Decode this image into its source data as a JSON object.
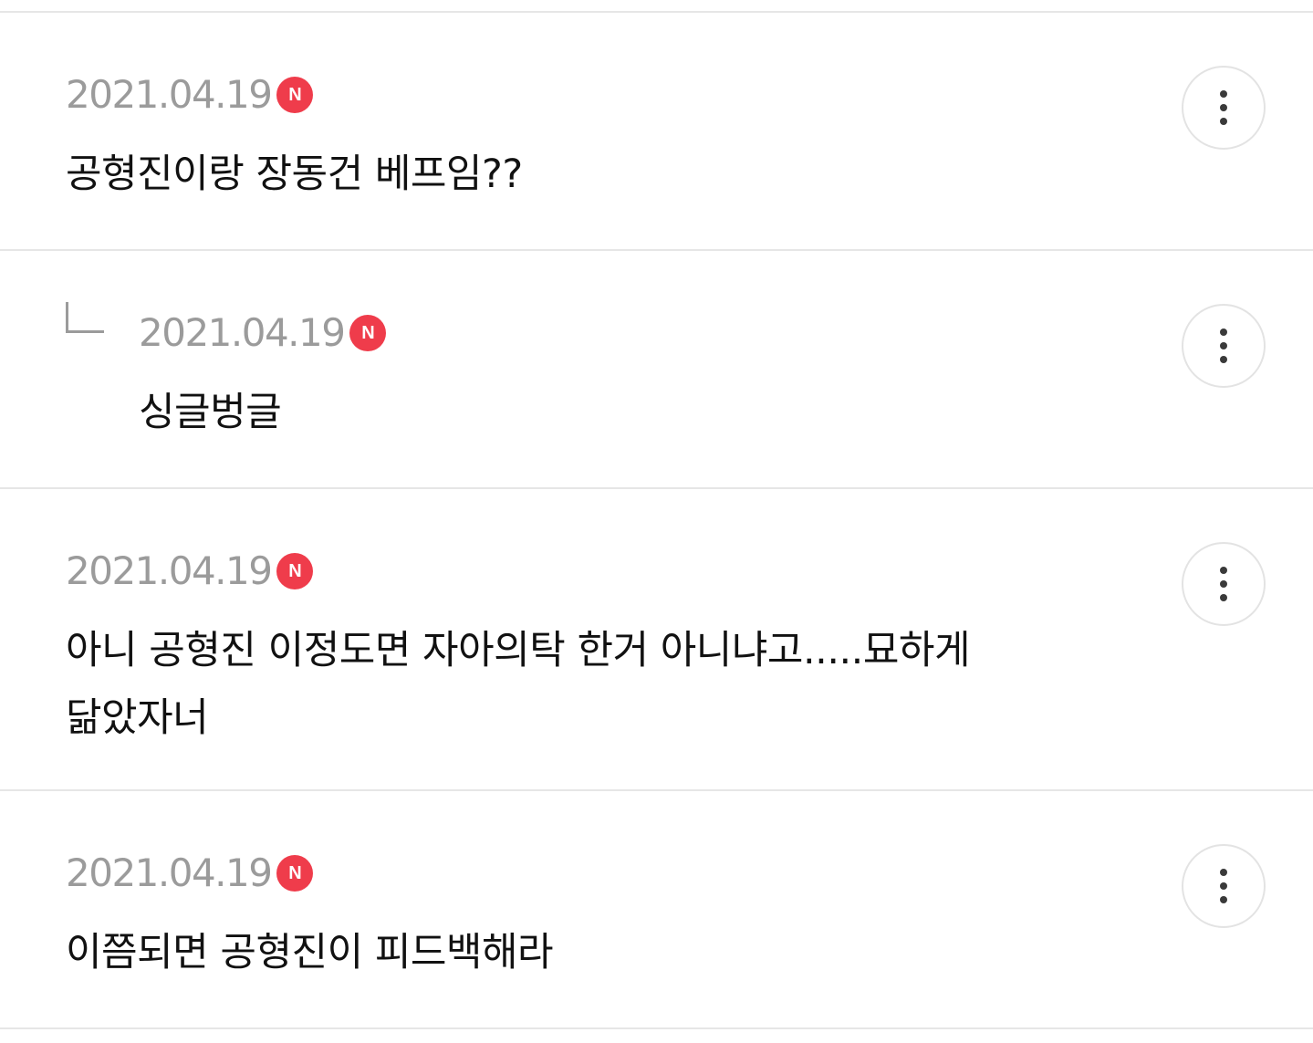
{
  "comments": [
    {
      "date": "2021.04.19",
      "badge": "N",
      "text": "공형진이랑 장동건 베프임??",
      "more_icon": "more-vertical-icon"
    },
    {
      "date": "2021.04.19",
      "badge": "N",
      "text": "싱글벙글",
      "is_reply": true,
      "reply_icon": "reply-arrow-icon",
      "more_icon": "more-vertical-icon"
    },
    {
      "date": "2021.04.19",
      "badge": "N",
      "text": "아니 공형진 이정도면 자아의탁 한거 아니냐고.....묘하게 닮았자너",
      "more_icon": "more-vertical-icon"
    },
    {
      "date": "2021.04.19",
      "badge": "N",
      "text": "이쯤되면 공형진이 피드백해라",
      "more_icon": "more-vertical-icon"
    }
  ],
  "colors": {
    "badge": "#ef3c4b",
    "date": "#9b9b9b",
    "text": "#111111",
    "divider": "#e6e6e6"
  }
}
